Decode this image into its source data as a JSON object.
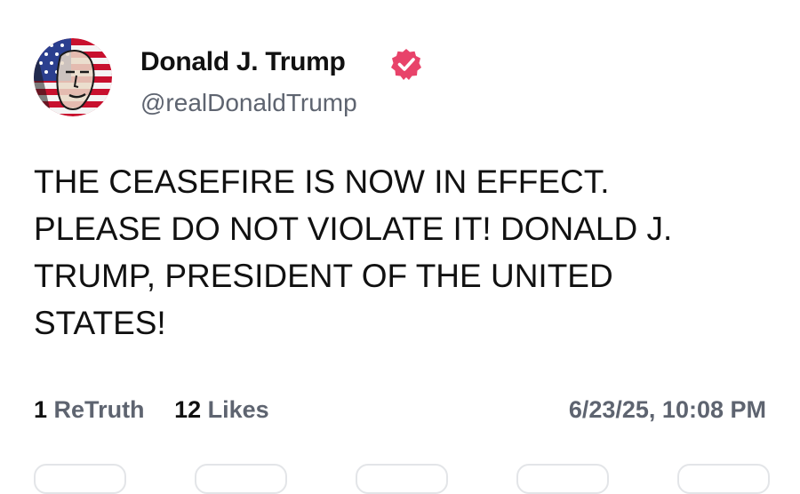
{
  "post": {
    "author_name": "Donald J. Trump",
    "handle": "@realDonaldTrump",
    "verified_icon": "verified-badge-icon",
    "text_lines": [
      "THE CEASEFIRE IS NOW IN EFFECT.",
      "PLEASE DO NOT VIOLATE IT! DONALD J.",
      "TRUMP, PRESIDENT OF THE UNITED",
      "STATES!"
    ],
    "retruths_count": "1",
    "retruths_label": "ReTruth",
    "likes_count": "12",
    "likes_label": "Likes",
    "timestamp": "6/23/25, 10:08 PM"
  },
  "colors": {
    "text_primary": "#111111",
    "text_secondary": "#5e6470",
    "verified_badge": "#e8436a",
    "avatar_red": "#c8102e",
    "avatar_blue": "#2b3f8f"
  }
}
